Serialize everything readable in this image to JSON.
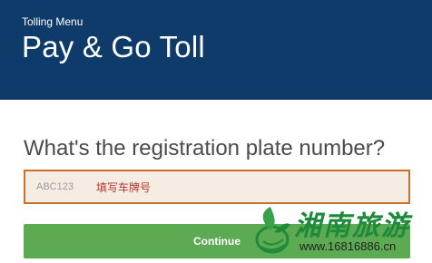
{
  "header": {
    "breadcrumb": "Tolling Menu",
    "title": "Pay & Go Toll",
    "background_color": "#0f3b6b"
  },
  "form": {
    "question": "What's the registration plate number?",
    "plate_input": {
      "placeholder": "ABC123",
      "value": "",
      "border_color": "#c9702d"
    },
    "hint_text": "填写车牌号",
    "continue_label": "Continue",
    "continue_color": "#5cab52"
  },
  "watermark": {
    "logo_icon": "leaf-swirl-icon",
    "site_name": "湘南旅游",
    "url": "www.16816886.cn"
  }
}
